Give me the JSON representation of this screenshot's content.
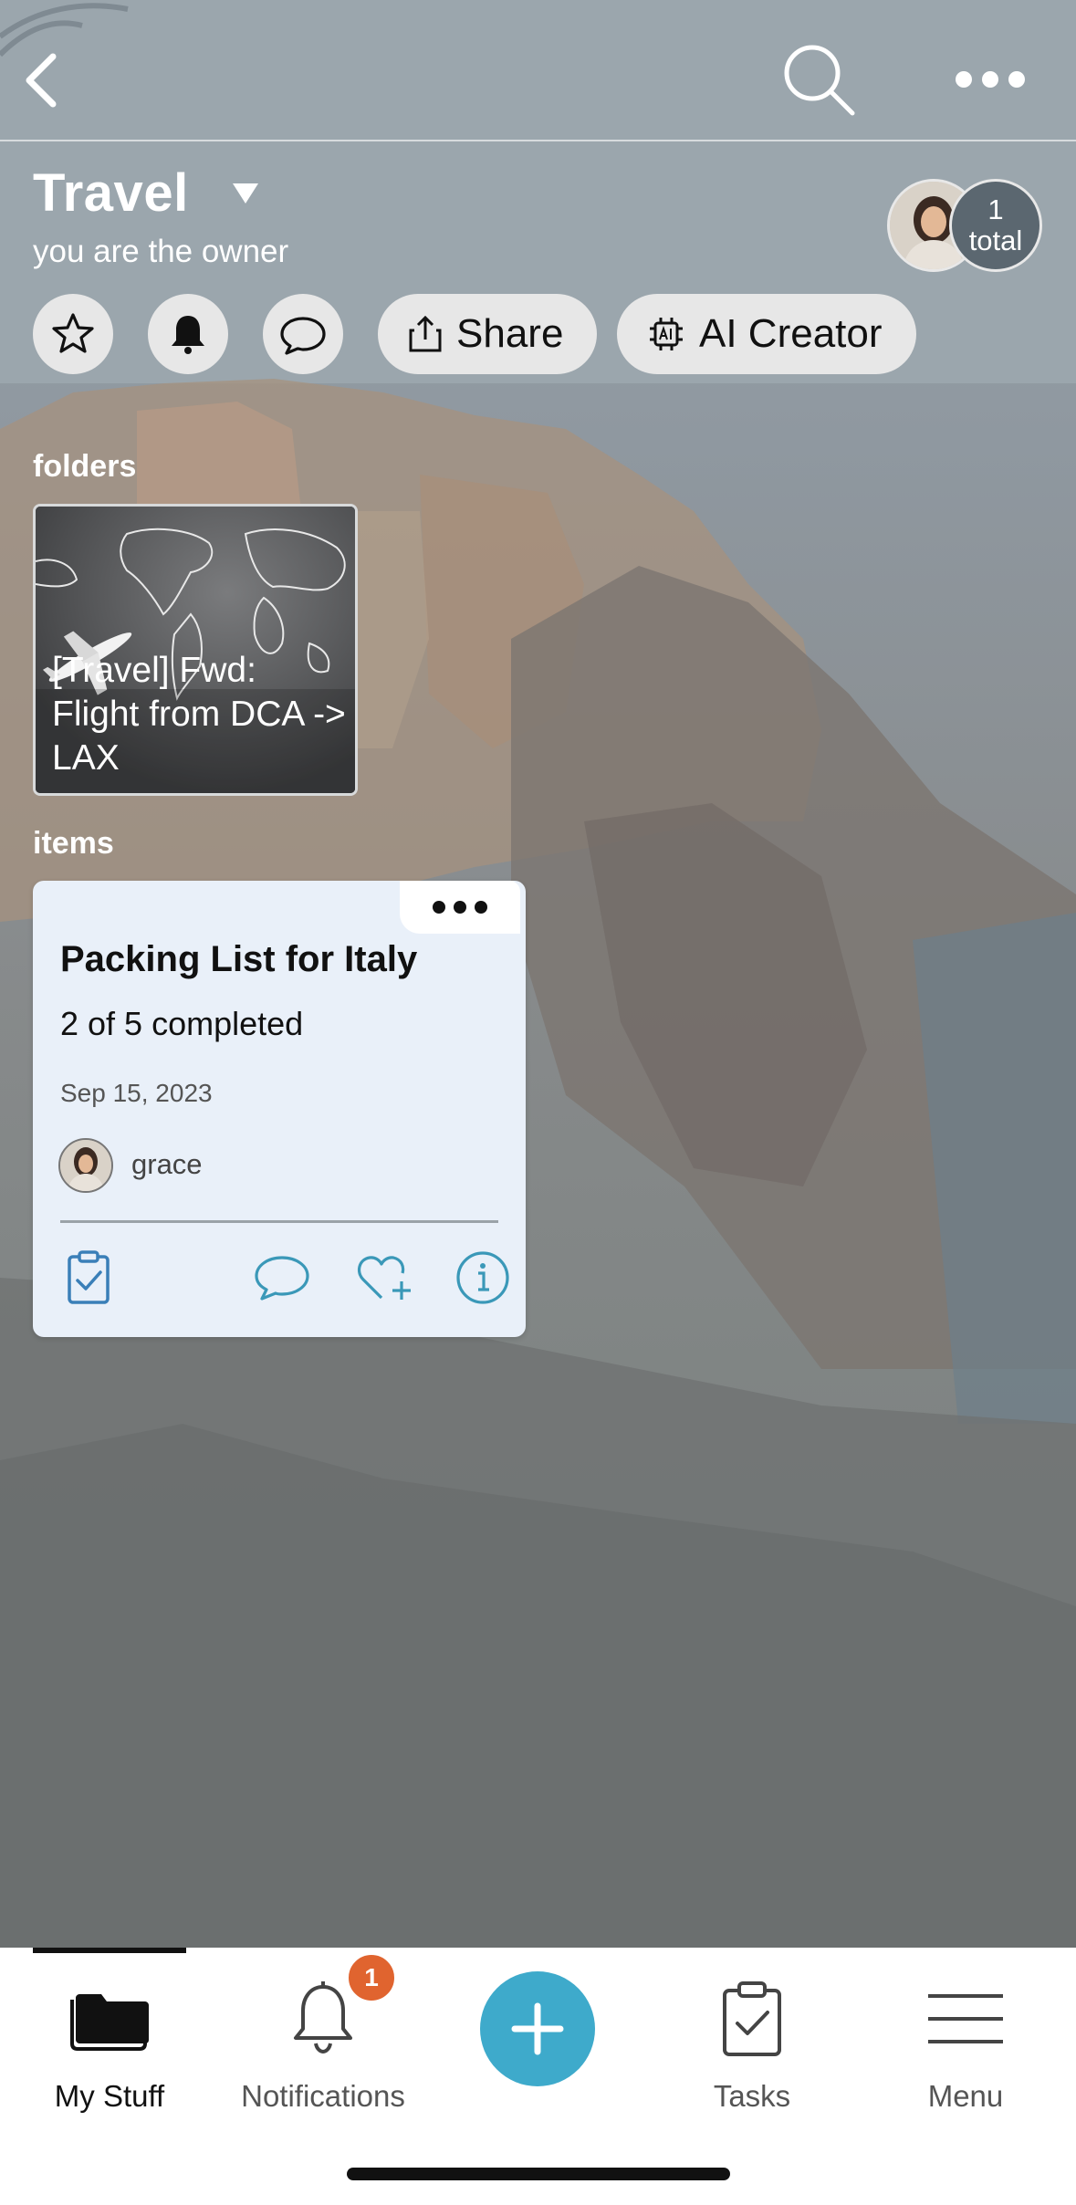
{
  "header": {
    "title": "Travel",
    "subtitle": "you are the owner",
    "members_total_count": "1",
    "members_total_label": "total"
  },
  "actions": {
    "share_label": "Share",
    "ai_creator_label": "AI Creator"
  },
  "sections": {
    "folders_label": "folders",
    "items_label": "items"
  },
  "folders": [
    {
      "name": "[Travel] Fwd: Flight from DCA -> LAX"
    }
  ],
  "items": [
    {
      "title": "Packing List for Italy",
      "progress": "2 of 5 completed",
      "date": "Sep 15, 2023",
      "user": "grace"
    }
  ],
  "bottom_nav": {
    "my_stuff": "My Stuff",
    "notifications": "Notifications",
    "notifications_badge": "1",
    "tasks": "Tasks",
    "menu": "Menu"
  },
  "colors": {
    "accent": "#3eaacb",
    "badge": "#e0642f",
    "card_bg": "#e9f0f9",
    "icon_teal": "#3a98b8"
  },
  "icons": [
    "chevron-left-icon",
    "search-icon",
    "more-horizontal-icon",
    "star-icon",
    "bell-icon",
    "chat-icon",
    "share-icon",
    "ai-chip-icon",
    "clipboard-check-icon",
    "heart-plus-icon",
    "info-icon",
    "folder-icon",
    "plus-icon",
    "menu-icon"
  ]
}
